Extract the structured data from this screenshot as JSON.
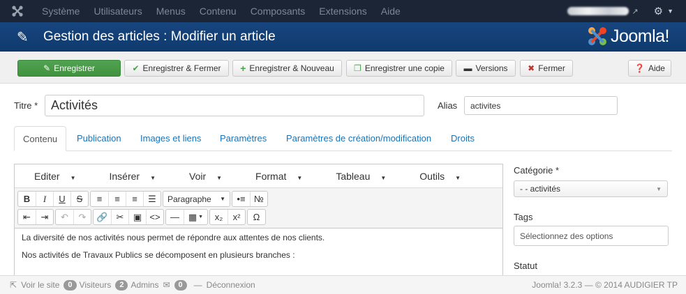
{
  "topnav": {
    "menu": [
      "Système",
      "Utilisateurs",
      "Menus",
      "Contenu",
      "Composants",
      "Extensions",
      "Aide"
    ],
    "icons": [
      "joomla-icon",
      "external-link-icon",
      "gear-icon"
    ]
  },
  "header": {
    "title": "Gestion des articles : Modifier un article",
    "brand": "Joomla!"
  },
  "toolbar": {
    "save": "Enregistrer",
    "save_close": "Enregistrer & Fermer",
    "save_new": "Enregistrer & Nouveau",
    "save_copy": "Enregistrer une copie",
    "versions": "Versions",
    "close": "Fermer",
    "help": "Aide"
  },
  "form": {
    "title_label": "Titre *",
    "title_value": "Activités",
    "alias_label": "Alias",
    "alias_value": "activites"
  },
  "tabs": [
    "Contenu",
    "Publication",
    "Images et liens",
    "Paramètres",
    "Paramètres de création/modification",
    "Droits"
  ],
  "editor": {
    "menu": [
      "Editer",
      "Insérer",
      "Voir",
      "Format",
      "Tableau",
      "Outils"
    ],
    "format_select": "Paragraphe",
    "content": [
      "La diversité de nos activités nous permet de répondre aux attentes de nos clients.",
      "Nos activités de Travaux Publics se décomposent en plusieurs branches :"
    ]
  },
  "sidebar": {
    "category_label": "Catégorie *",
    "category_value": "- - activités",
    "tags_label": "Tags",
    "tags_placeholder": "Sélectionnez des options",
    "status_label": "Statut"
  },
  "statusbar": {
    "view_site": "Voir le site",
    "visitors_count": "0",
    "visitors_label": "Visiteurs",
    "admins_count": "2",
    "admins_label": "Admins",
    "messages_count": "0",
    "logout": "Déconnexion",
    "copyright": "Joomla! 3.2.3  —  © 2014 AUDIGIER TP"
  },
  "colors": {
    "topnav_bg": "#1c2535",
    "header_bg": "#17457e",
    "save_green": "#46a546",
    "link_blue": "#1a73b7"
  }
}
